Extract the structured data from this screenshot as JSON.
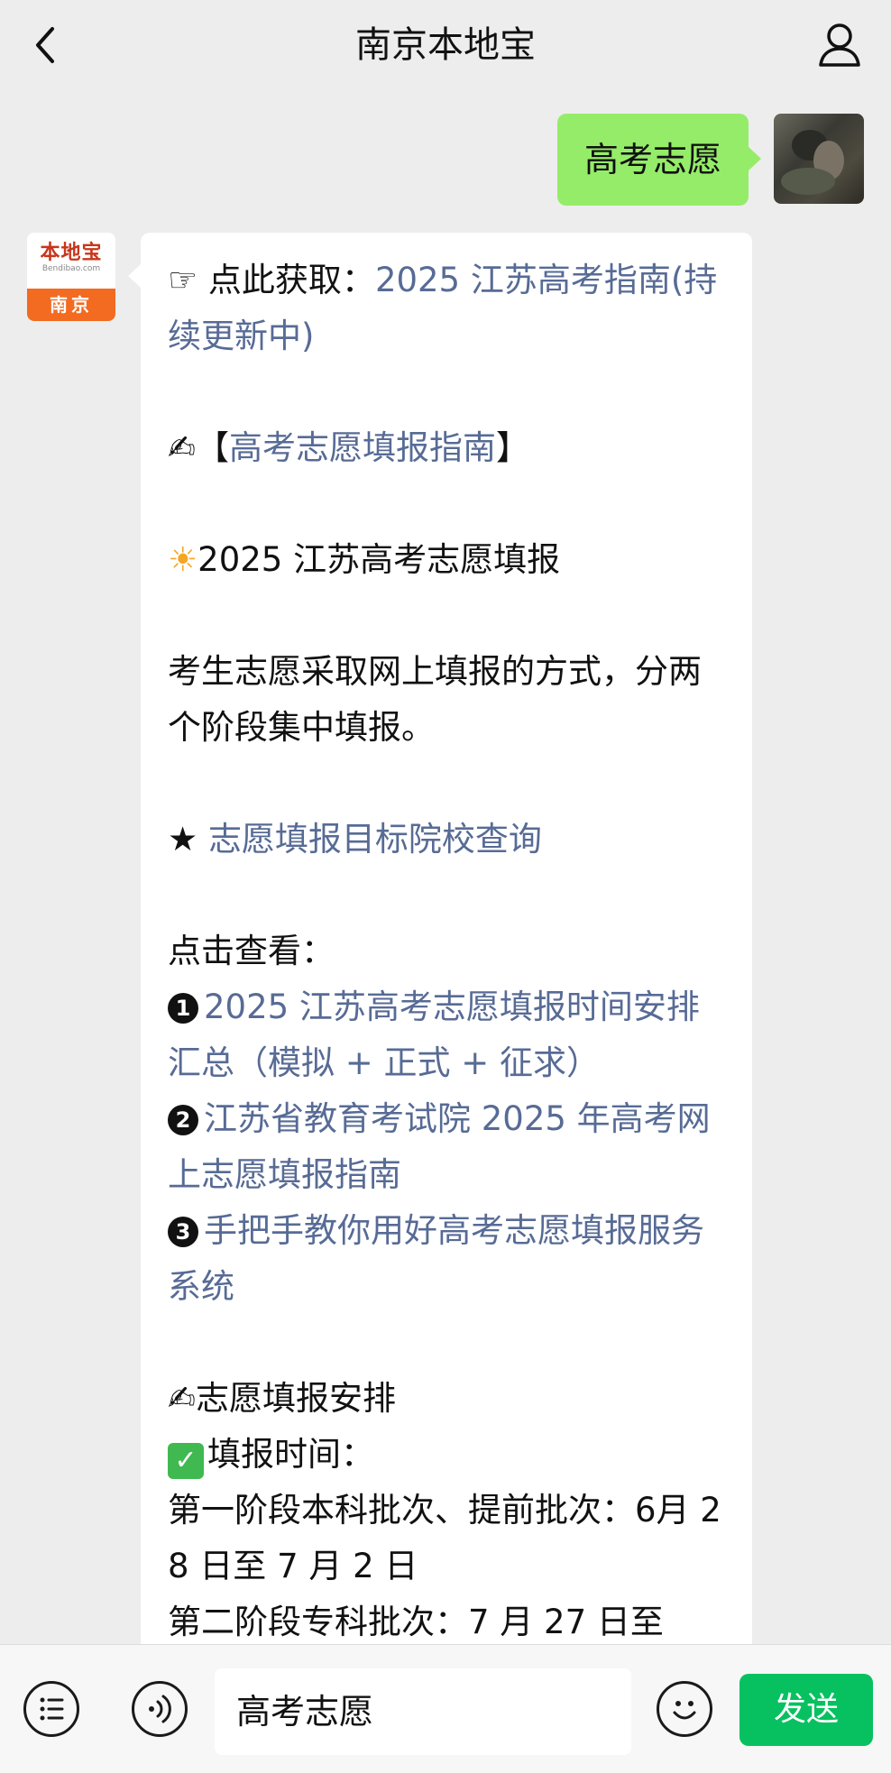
{
  "header": {
    "title": "南京本地宝"
  },
  "outgoing": {
    "text": "高考志愿"
  },
  "brand_avatar": {
    "logo": "本地宝",
    "url": "Bendibao.com",
    "city": "南京"
  },
  "message": {
    "p1_prefix": "☞ 点此获取：",
    "p1_link": "2025 江苏高考指南(持续更新中)",
    "p2_emoji": "✍",
    "p2_open": "【",
    "p2_link": "高考志愿填报指南",
    "p2_close": "】",
    "p3_emoji": "☀",
    "p3_text": "2025 江苏高考志愿填报",
    "p4_text": "考生志愿采取网上填报的方式，分两个阶段集中填报。",
    "p5_star": "★ ",
    "p5_link": "志愿填报目标院校查询",
    "p6_label": "点击查看：",
    "items": [
      {
        "num": "1",
        "text": "2025 江苏高考志愿填报时间安排汇总（模拟 + 正式 + 征求）"
      },
      {
        "num": "2",
        "text": "江苏省教育考试院 2025 年高考网上志愿填报指南"
      },
      {
        "num": "3",
        "text": "手把手教你用好高考志愿填报服务系统"
      }
    ],
    "p7_emoji": "✍",
    "p7_text": "志愿填报安排",
    "p8_check": "✓",
    "p8_text": "填报时间：",
    "p9_text": "第一阶段本科批次、提前批次：6月 28 日至 7 月 2 日",
    "p10_text": "第二阶段专科批次：7 月 27 日至"
  },
  "bottom": {
    "input_value": "高考志愿",
    "send_label": "发送"
  }
}
